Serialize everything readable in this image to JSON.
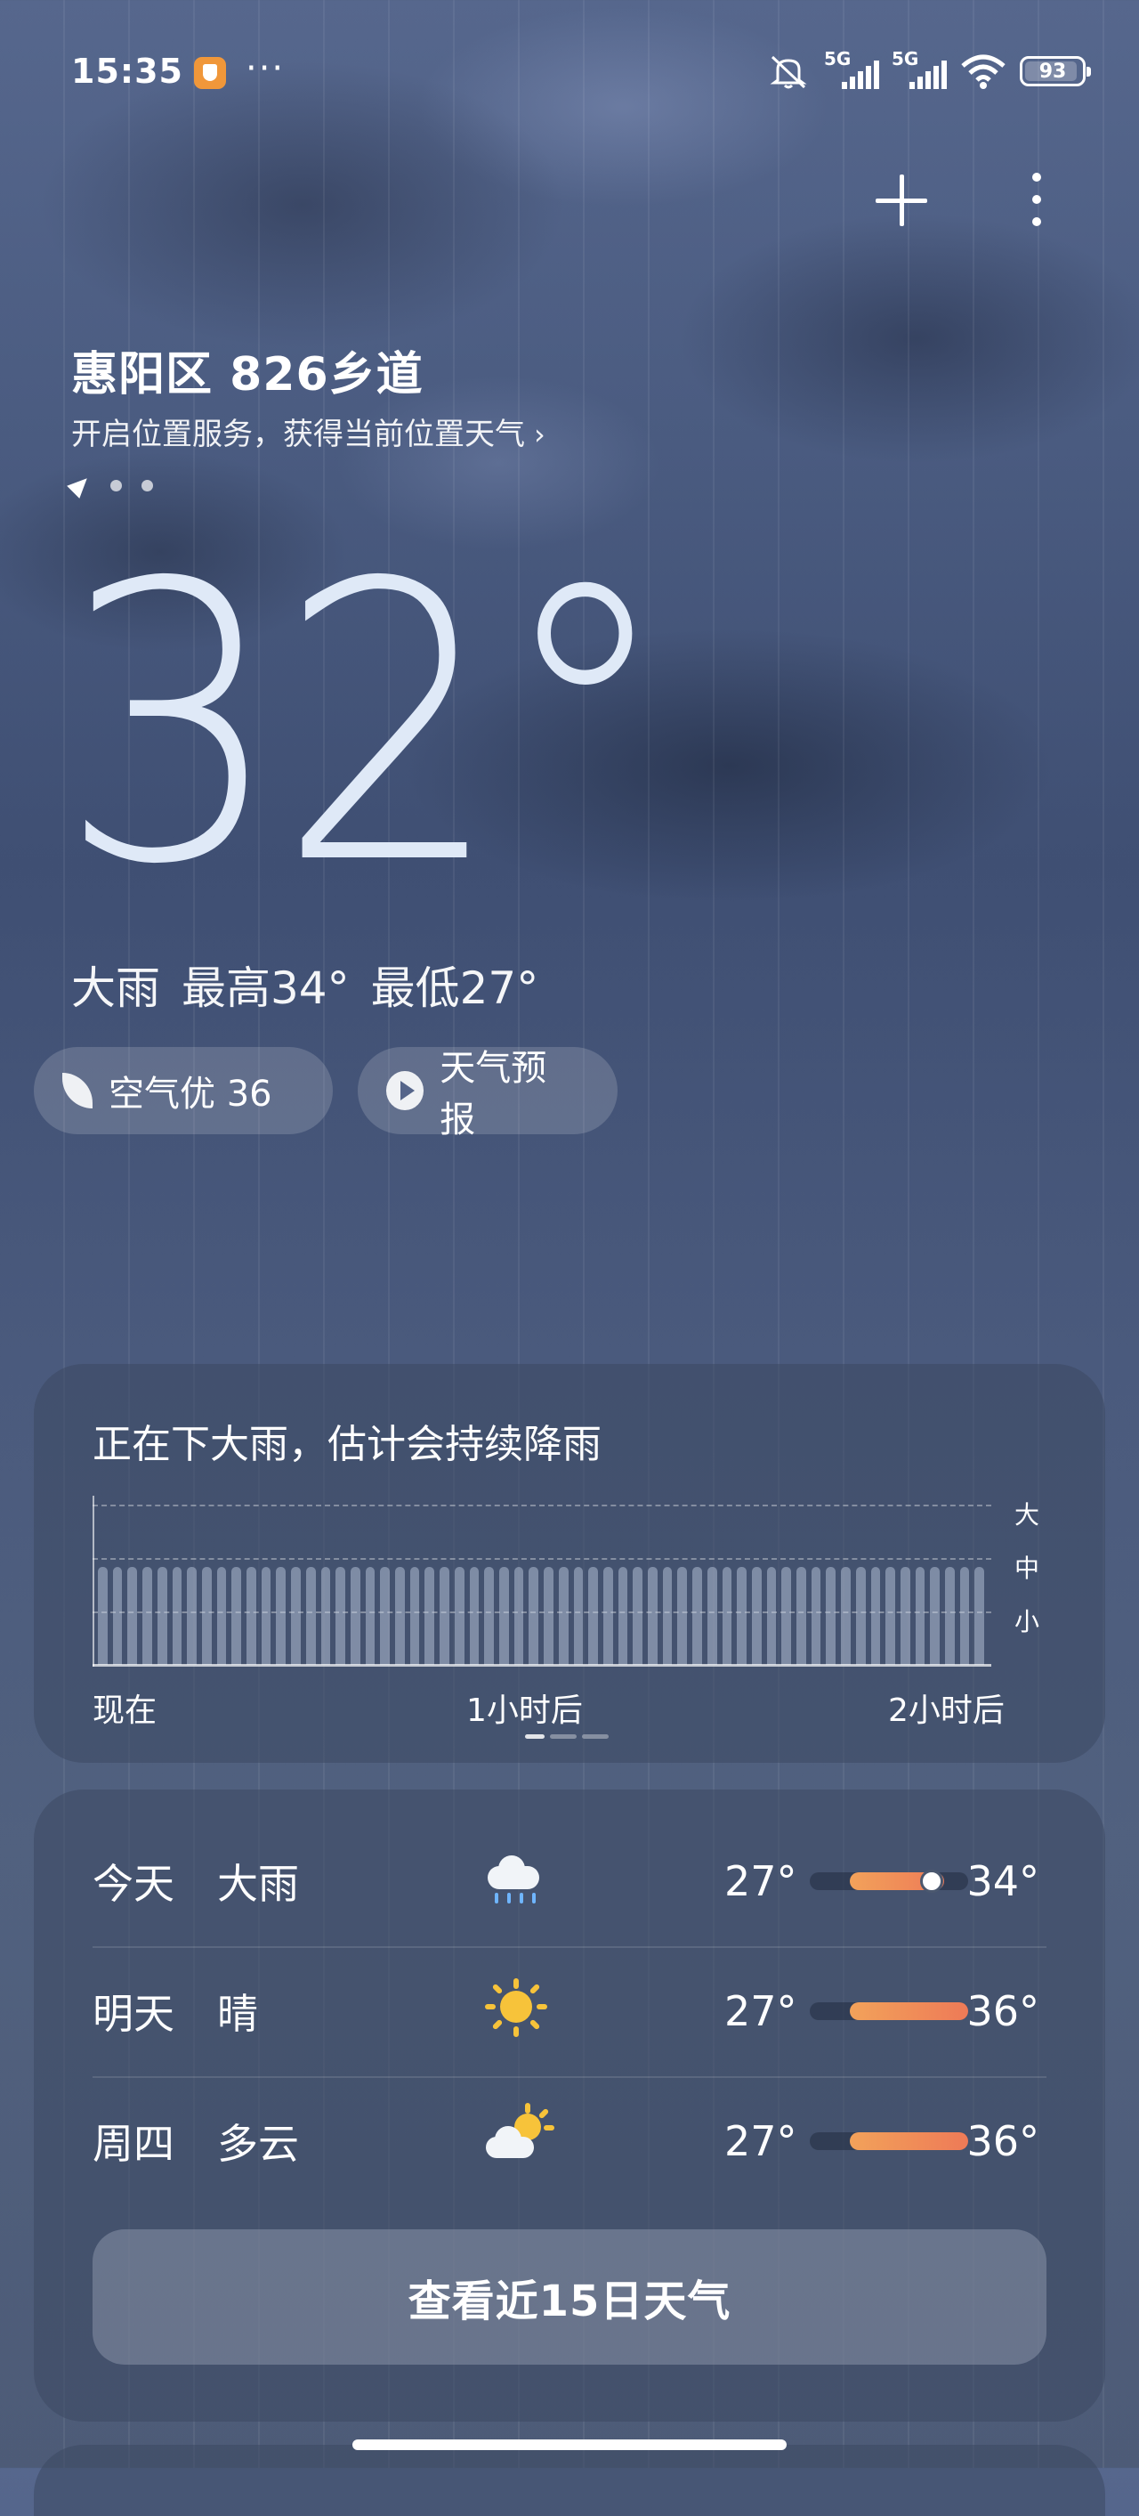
{
  "status_bar": {
    "time": "15:35",
    "signal1_label": "5G",
    "signal2_label": "5G",
    "battery": "93",
    "icons": [
      "security-shield-icon",
      "more-notifications-icon",
      "silent-bell-icon",
      "signal-icon",
      "signal-icon",
      "wifi-icon",
      "battery-icon"
    ]
  },
  "header": {
    "location": "惠阳区 826乡道",
    "location_hint": "开启位置服务，获得当前位置天气",
    "location_hint_chevron": "›"
  },
  "current": {
    "temperature": "32°",
    "condition": "大雨",
    "high": "最高34°",
    "low": "最低27°"
  },
  "chips": {
    "air": "空气优 36",
    "forecast": "天气预报"
  },
  "rain_card": {
    "title": "正在下大雨，估计会持续降雨",
    "levels": [
      "大",
      "中",
      "小"
    ],
    "x_labels": [
      "现在",
      "1小时后",
      "2小时后"
    ]
  },
  "chart_data": {
    "type": "bar",
    "categories": [
      "现在",
      "1小时后",
      "2小时后"
    ],
    "y_categories": [
      "小",
      "中",
      "大"
    ],
    "values_level": [
      2.2,
      2.2,
      2.2
    ],
    "xlabel": "",
    "ylabel": ""
  },
  "forecast": {
    "rows": [
      {
        "day": "今天",
        "cond": "大雨",
        "icon": "heavy-rain-icon",
        "lo": "27°",
        "hi": "34°",
        "range_start": 0.25,
        "range_end": 0.85,
        "now": 0.75
      },
      {
        "day": "明天",
        "cond": "晴",
        "icon": "sunny-icon",
        "lo": "27°",
        "hi": "36°",
        "range_start": 0.25,
        "range_end": 1.0
      },
      {
        "day": "周四",
        "cond": "多云",
        "icon": "partly-cloudy-icon",
        "lo": "27°",
        "hi": "36°",
        "range_start": 0.25,
        "range_end": 1.0
      }
    ],
    "button": "查看近15日天气"
  },
  "colors": {
    "temp_bar_start": "#f2a25a",
    "temp_bar_end": "#ee7a57",
    "sun": "#f7c33a",
    "shield": "#f0973a"
  }
}
